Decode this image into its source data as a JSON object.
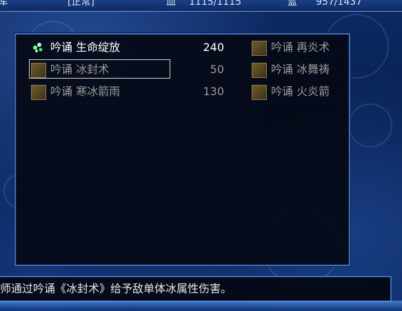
{
  "status": {
    "left_char": "军",
    "state": "[正常]",
    "hp_label": "血",
    "hp_value": "1115/1115",
    "mp_label": "蓝",
    "mp_value": "957/1437"
  },
  "skills": [
    {
      "name": "吟诵 生命绽放",
      "cost": "240",
      "icon": "green-sparkle-icon",
      "enabled": true
    },
    {
      "name": "吟诵 冰封术",
      "cost": "50",
      "icon": "feather-scroll-icon",
      "enabled": false,
      "selected": true
    },
    {
      "name": "吟诵 寒冰箭雨",
      "cost": "130",
      "icon": "feather-scroll-icon",
      "enabled": false
    },
    {
      "name": "吟诵 再炎术",
      "cost": "",
      "icon": "feather-scroll-icon",
      "enabled": false
    },
    {
      "name": "吟诵 冰舞祷",
      "cost": "",
      "icon": "feather-scroll-icon",
      "enabled": false
    },
    {
      "name": "吟诵 火炎箭",
      "cost": "",
      "icon": "feather-scroll-icon",
      "enabled": false
    }
  ],
  "message": "师通过吟诵《冰封术》给予敌单体冰属性伤害。",
  "colors": {
    "border": "#3f6fb5",
    "enabled_text": "#ffffff",
    "disabled_text": "#9a9a9a"
  }
}
